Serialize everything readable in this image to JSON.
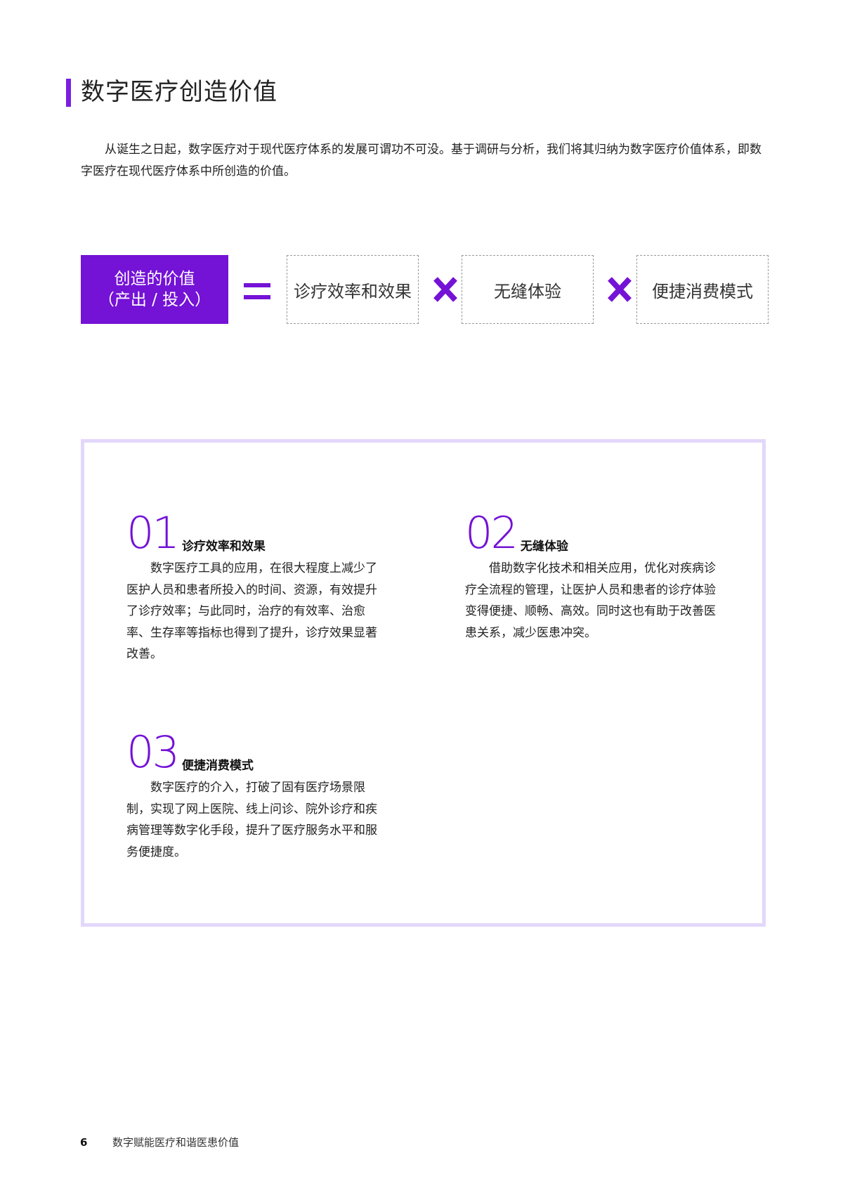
{
  "page_title": "数字医疗创造价值",
  "intro": "从诞生之日起，数字医疗对于现代医疗体系的发展可谓功不可没。基于调研与分析，我们将其归纳为数字医疗价值体系，即数字医疗在现代医疗体系中所创造的价值。",
  "formula": {
    "value_line1": "创造的价值",
    "value_line2": "（产出 / 投入）",
    "factors": [
      "诊疗效率和效果",
      "无缝体验",
      "便捷消费模式"
    ]
  },
  "items": [
    {
      "number": "01",
      "heading": "诊疗效率和效果",
      "body": "数字医疗工具的应用，在很大程度上减少了医护人员和患者所投入的时间、资源，有效提升了诊疗效率；与此同时，治疗的有效率、治愈率、生存率等指标也得到了提升，诊疗效果显著改善。"
    },
    {
      "number": "02",
      "heading": "无缝体验",
      "body": "借助数字化技术和相关应用，优化对疾病诊疗全流程的管理，让医护人员和患者的诊疗体验变得便捷、顺畅、高效。同时这也有助于改善医患关系，减少医患冲突。"
    },
    {
      "number": "03",
      "heading": "便捷消费模式",
      "body": "数字医疗的介入，打破了固有医疗场景限制，实现了网上医院、线上问诊、院外诊疗和疾病管理等数字化手段，提升了医疗服务水平和服务便捷度。"
    }
  ],
  "footer": {
    "page_number": "6",
    "doc_title": "数字赋能医疗和谐医患价值"
  },
  "colors": {
    "accent": "#7412d6",
    "panel_border": "#e3d7fb"
  },
  "icons": [
    "equals-icon",
    "multiply-icon"
  ]
}
